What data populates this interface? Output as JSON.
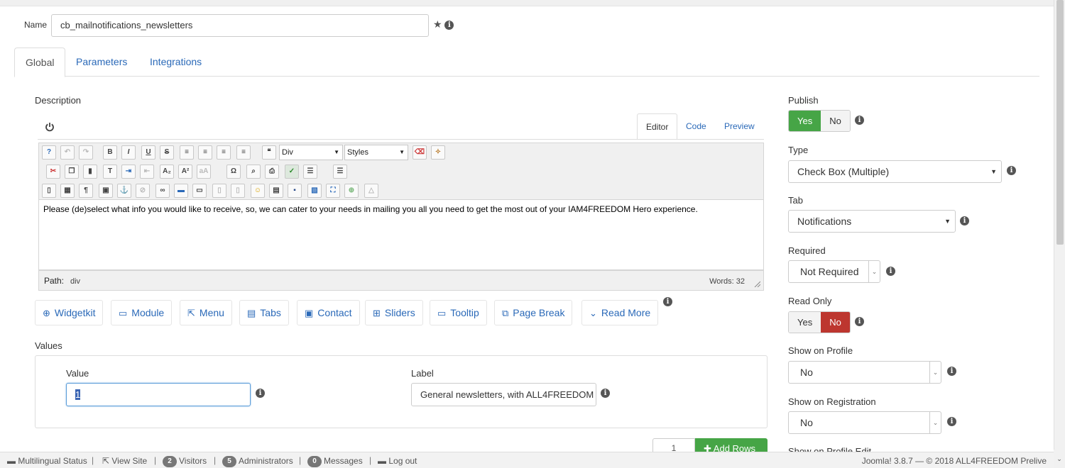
{
  "form": {
    "name_label": "Name",
    "name_value": "cb_mailnotifications_newsletters",
    "tabs": [
      {
        "label": "Global"
      },
      {
        "label": "Parameters"
      },
      {
        "label": "Integrations"
      }
    ]
  },
  "description": {
    "label": "Description",
    "editor_tabs": [
      {
        "label": "Editor"
      },
      {
        "label": "Code"
      },
      {
        "label": "Preview"
      }
    ],
    "format_select": "Div",
    "styles_select": "Styles",
    "content": "Please (de)select what info you would like to receive, so, we can cater to your needs in mailing you all you need to get the most out of your IAM4FREEDOM Hero experience.",
    "path_label": "Path:",
    "path_value": "div",
    "words": "Words: 32"
  },
  "editor_buttons": [
    {
      "label": "Widgetkit",
      "icon": "plus-circle-icon",
      "glyph": "⊕"
    },
    {
      "label": "Module",
      "icon": "module-icon",
      "glyph": "▭"
    },
    {
      "label": "Menu",
      "icon": "share-icon",
      "glyph": "⇱"
    },
    {
      "label": "Tabs",
      "icon": "tabs-icon",
      "glyph": "▤"
    },
    {
      "label": "Contact",
      "icon": "address-card-icon",
      "glyph": "▣"
    },
    {
      "label": "Sliders",
      "icon": "sliders-icon",
      "glyph": "⊞"
    },
    {
      "label": "Tooltip",
      "icon": "comment-icon",
      "glyph": "▭"
    },
    {
      "label": "Page Break",
      "icon": "copy-icon",
      "glyph": "⧉"
    },
    {
      "label": "Read More",
      "icon": "chevron-down-icon",
      "glyph": "⌄"
    }
  ],
  "values": {
    "section_label": "Values",
    "value_label": "Value",
    "label_label": "Label",
    "value": "1",
    "label_value": "General newsletters, with ALL4FREEDOM",
    "rows_count": "1",
    "add_rows_label": "Add Rows"
  },
  "sidebar": {
    "publish": {
      "label": "Publish",
      "yes": "Yes",
      "no": "No",
      "active": "Yes"
    },
    "type": {
      "label": "Type",
      "value": "Check Box (Multiple)"
    },
    "tab": {
      "label": "Tab",
      "value": "Notifications"
    },
    "required": {
      "label": "Required",
      "value": "Not Required"
    },
    "read_only": {
      "label": "Read Only",
      "yes": "Yes",
      "no": "No",
      "active": "No"
    },
    "show_on_profile": {
      "label": "Show on Profile",
      "value": "No"
    },
    "show_on_registration": {
      "label": "Show on Registration",
      "value": "No"
    },
    "show_on_profile_edit": {
      "label": "Show on Profile Edit"
    }
  },
  "footer": {
    "multilingual": "Multilingual Status",
    "view_site": "View Site",
    "visitors_count": "2",
    "visitors_label": "Visitors",
    "admins_count": "5",
    "admins_label": "Administrators",
    "messages_count": "0",
    "messages_label": "Messages",
    "logout": "Log out",
    "copyright": "Joomla! 3.8.7  —  © 2018 ALL4FREEDOM Prelive"
  },
  "colors": {
    "link": "#2a69b8",
    "success": "#46a546",
    "danger": "#bd362f"
  }
}
